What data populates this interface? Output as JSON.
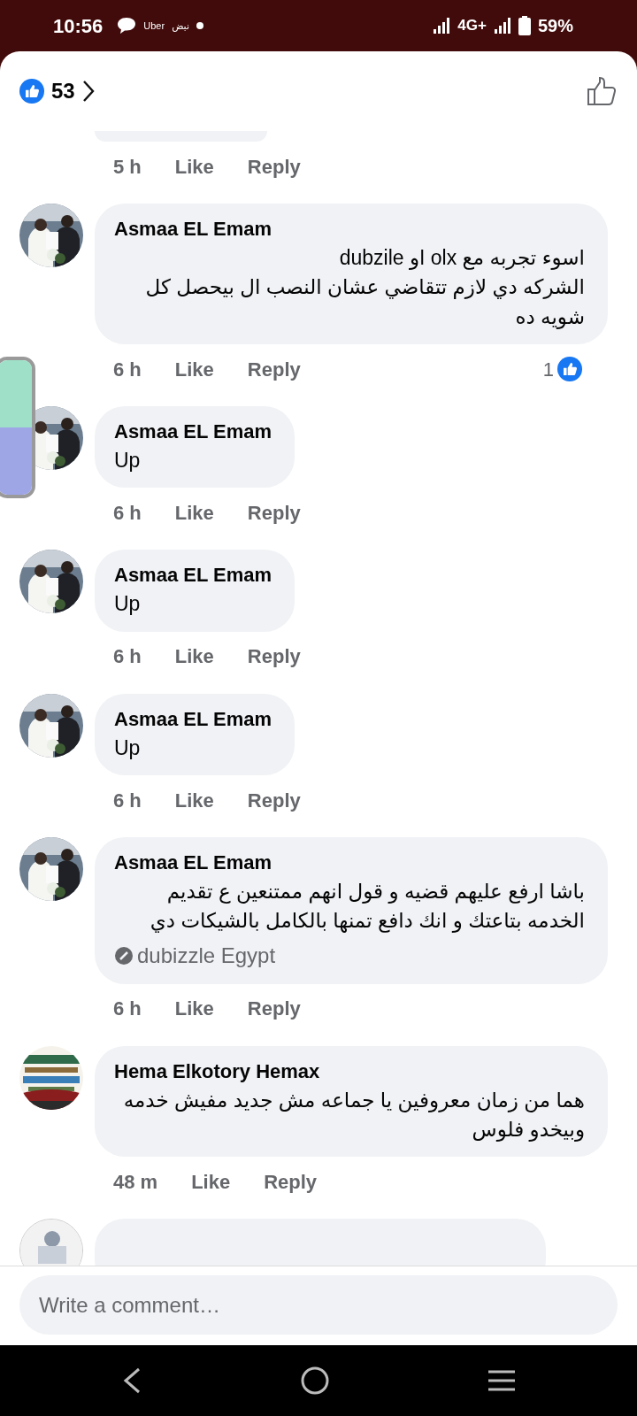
{
  "status_bar": {
    "time": "10:56",
    "notifications": [
      "Uber",
      "نبض"
    ],
    "network": "4G+",
    "battery": "59%"
  },
  "reactions": {
    "count": "53"
  },
  "previous_comment": {
    "time": "5 h",
    "like": "Like",
    "reply": "Reply"
  },
  "comments": [
    {
      "author": "Asmaa EL Emam",
      "text": [
        "اسوء تجربه مع olx او dubzile",
        "الشركه دي لازم تتقاضي عشان النصب ال بيحصل كل شويه ده"
      ],
      "time": "6 h",
      "like": "Like",
      "reply": "Reply",
      "likes": "1"
    },
    {
      "author": "Asmaa EL Emam",
      "text": [
        "Up"
      ],
      "time": "6 h",
      "like": "Like",
      "reply": "Reply"
    },
    {
      "author": "Asmaa EL Emam",
      "text": [
        "Up"
      ],
      "time": "6 h",
      "like": "Like",
      "reply": "Reply"
    },
    {
      "author": "Asmaa EL Emam",
      "text": [
        "Up"
      ],
      "time": "6 h",
      "like": "Like",
      "reply": "Reply"
    },
    {
      "author": "Asmaa EL Emam",
      "text": [
        "باشا ارفع عليهم قضيه و قول انهم ممتنعين ع تقديم الخدمه بتاعتك و انك دافع تمنها بالكامل بالشيكات دي"
      ],
      "tag": "dubizzle Egypt",
      "time": "6 h",
      "like": "Like",
      "reply": "Reply"
    },
    {
      "author": "Hema Elkotory Hemax",
      "text": [
        "هما من زمان معروفين يا جماعه مش جديد مفيش خدمه وبيخدو فلوس"
      ],
      "time": "48 m",
      "like": "Like",
      "reply": "Reply"
    }
  ],
  "composer": {
    "placeholder": "Write a comment…"
  }
}
